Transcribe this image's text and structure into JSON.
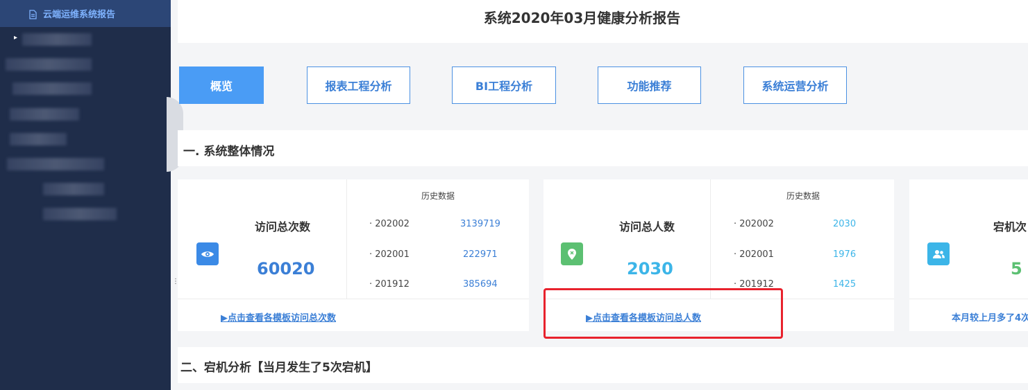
{
  "sidebar": {
    "active_item": "云端运维系统报告"
  },
  "header": {
    "title": "系统2020年03月健康分析报告"
  },
  "tabs": [
    {
      "label": "概览",
      "active": true
    },
    {
      "label": "报表工程分析",
      "active": false
    },
    {
      "label": "BI工程分析",
      "active": false
    },
    {
      "label": "功能推荐",
      "active": false
    },
    {
      "label": "系统运营分析",
      "active": false
    }
  ],
  "sections": {
    "overview": "一. 系统整体情况",
    "downtime": "二、宕机分析【当月发生了5次宕机】"
  },
  "cards": [
    {
      "title": "访问总次数",
      "value": "60020",
      "value_color": "#3b7fd6",
      "icon": "eye-icon",
      "icon_color": "#3b8ae6",
      "history_title": "历史数据",
      "history": [
        {
          "period": "· 202002",
          "value": "3139719"
        },
        {
          "period": "· 202001",
          "value": "222971"
        },
        {
          "period": "· 201912",
          "value": "385694"
        }
      ],
      "history_color": "#3b7fd6",
      "link": "▶点击查看各模板访问总次数"
    },
    {
      "title": "访问总人数",
      "value": "2030",
      "value_color": "#3cb5e8",
      "icon": "location-pin-icon",
      "icon_color": "#5cc072",
      "history_title": "历史数据",
      "history": [
        {
          "period": "· 202002",
          "value": "2030"
        },
        {
          "period": "· 202001",
          "value": "1976"
        },
        {
          "period": "· 201912",
          "value": "1425"
        }
      ],
      "history_color": "#3cb5e8",
      "link": "▶点击查看各模板访问总人数"
    },
    {
      "title": "宕机次",
      "value": "5",
      "value_color": "#5cc072",
      "icon": "users-icon",
      "icon_color": "#3cb5e8",
      "link": "本月较上月多了4次"
    }
  ]
}
